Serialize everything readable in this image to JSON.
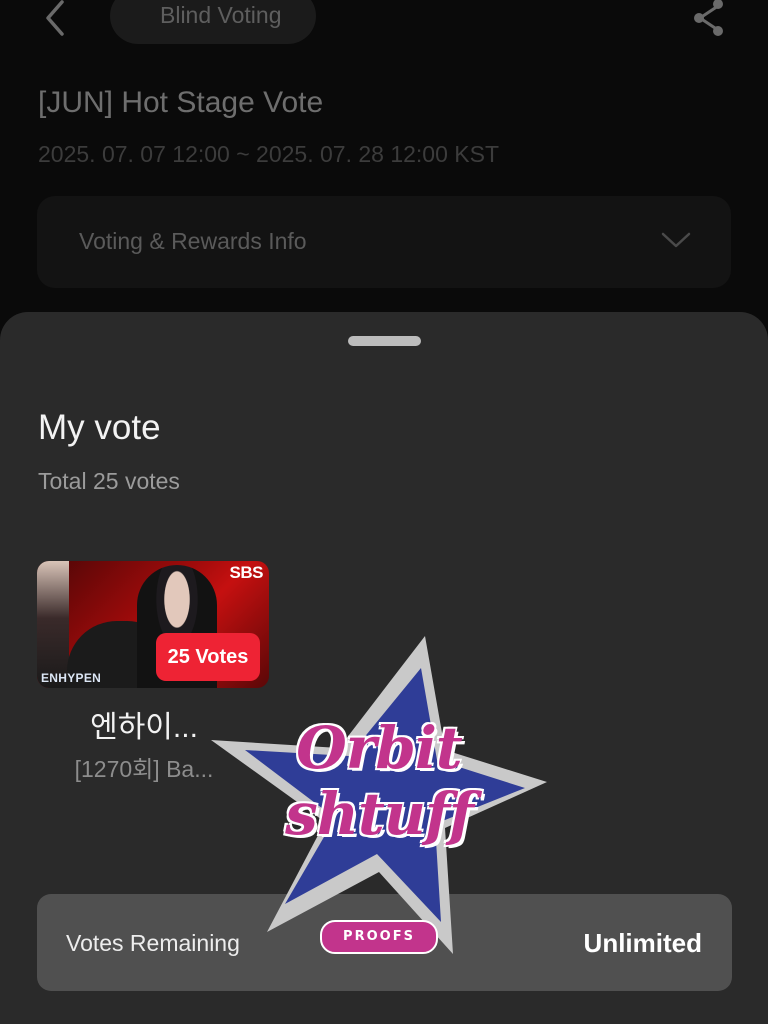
{
  "header": {
    "tab_label": "Blind Voting",
    "title": "[JUN] Hot Stage Vote",
    "dates": "2025. 07. 07 12:00 ~ 2025. 07. 28 12:00 KST"
  },
  "info_box": {
    "label": "Voting & Rewards Info"
  },
  "sheet": {
    "title": "My vote",
    "total": "Total 25 votes",
    "card": {
      "channel_logo": "SBS",
      "group_tag": "ENHYPEN",
      "votes_badge": "25 Votes",
      "name": "엔하이...",
      "subtitle": "[1270회] Ba..."
    },
    "remaining": {
      "label": "Votes Remaining",
      "value": "Unlimited"
    }
  },
  "watermark": {
    "line1": "Orbit",
    "line2": "shtuff",
    "tag": "PROOFS"
  },
  "colors": {
    "badge": "#ee2334",
    "sheet_bg": "#2a2a2a",
    "remaining_bg": "#505050",
    "sticker_blue": "#2f3d97",
    "sticker_pink": "#c2348c"
  },
  "icons": [
    "back-icon",
    "share-icon",
    "chevron-down-icon"
  ]
}
